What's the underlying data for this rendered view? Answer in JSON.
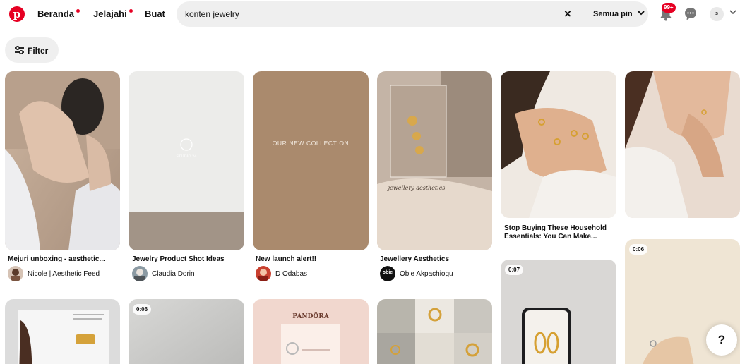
{
  "header": {
    "logo_letter": "p",
    "nav": [
      {
        "label": "Beranda",
        "dot": true
      },
      {
        "label": "Jelajahi",
        "dot": true
      },
      {
        "label": "Buat",
        "dot": false
      }
    ],
    "search_value": "konten jewelry",
    "clear_icon": "×",
    "scope_label": "Semua pin",
    "notifications_badge": "99+",
    "avatar_initial": "s"
  },
  "filter_label": "Filter",
  "pins": [
    {
      "title": "Mejuri unboxing - aesthetic...",
      "author": "Nicole | Aesthetic Feed"
    },
    {
      "title": "Jewelry Product Shot Ideas",
      "author": "Claudia Dorin",
      "overlay": "STUDIO 24"
    },
    {
      "title": "New launch alert!!",
      "author": "D Odabas",
      "overlay": "OUR NEW COLLECTION"
    },
    {
      "title": "Jewellery Aesthetics",
      "author": "Obie Akpachiogu",
      "overlay": "jewellery aesthetics",
      "author_logo": "obie"
    },
    {
      "title_lines": [
        "Stop Buying These Household",
        "Essentials: You Can Make..."
      ]
    },
    {},
    {
      "duration": "0:07"
    },
    {
      "duration": "0:06"
    },
    {},
    {
      "duration": "0:06"
    },
    {
      "overlay": "PANDÖRA"
    },
    {}
  ],
  "help_label": "?",
  "colors": {
    "brand": "#e60023",
    "search_bg": "#efefef"
  }
}
